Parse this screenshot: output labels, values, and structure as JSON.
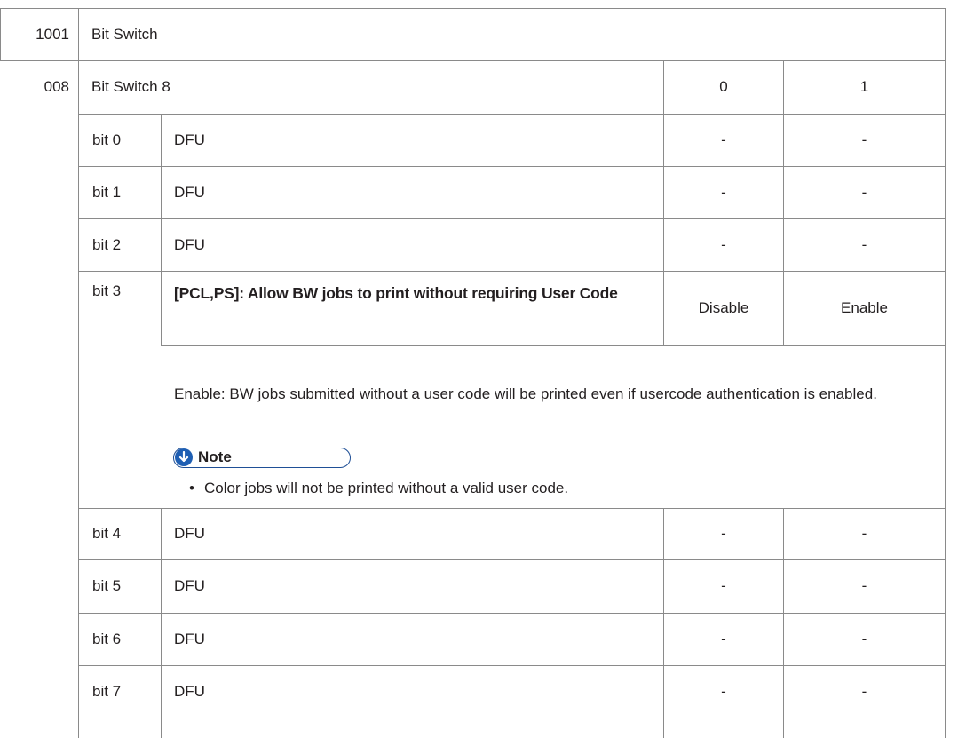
{
  "row_1001": {
    "code": "1001",
    "title": "Bit Switch"
  },
  "row_008": {
    "code": "008",
    "title": "Bit Switch 8",
    "col0": "0",
    "col1": "1"
  },
  "bits": [
    {
      "bit": "bit 0",
      "desc": "DFU",
      "v0": "-",
      "v1": "-"
    },
    {
      "bit": "bit 1",
      "desc": "DFU",
      "v0": "-",
      "v1": "-"
    },
    {
      "bit": "bit 2",
      "desc": "DFU",
      "v0": "-",
      "v1": "-"
    },
    {
      "bit": "bit 3",
      "desc": "[PCL,PS]: Allow BW jobs to print without requiring User Code",
      "v0": "Disable",
      "v1": "Enable"
    },
    {
      "bit": "bit 4",
      "desc": "DFU",
      "v0": "-",
      "v1": "-"
    },
    {
      "bit": "bit 5",
      "desc": "DFU",
      "v0": "-",
      "v1": "-"
    },
    {
      "bit": "bit 6",
      "desc": "DFU",
      "v0": "-",
      "v1": "-"
    },
    {
      "bit": "bit 7",
      "desc": "DFU",
      "v0": "-",
      "v1": "-"
    }
  ],
  "bit3_detail": {
    "text": "Enable: BW jobs submitted without a user code will be printed even if usercode authentication is enabled.",
    "note_label": "Note",
    "note_icon": "down-arrow-circle-icon",
    "bullet": "Color jobs will not be printed without a valid user code."
  },
  "colors": {
    "note_accent": "#1f5fb3",
    "border": "#8a8a8a",
    "text": "#231f20"
  }
}
